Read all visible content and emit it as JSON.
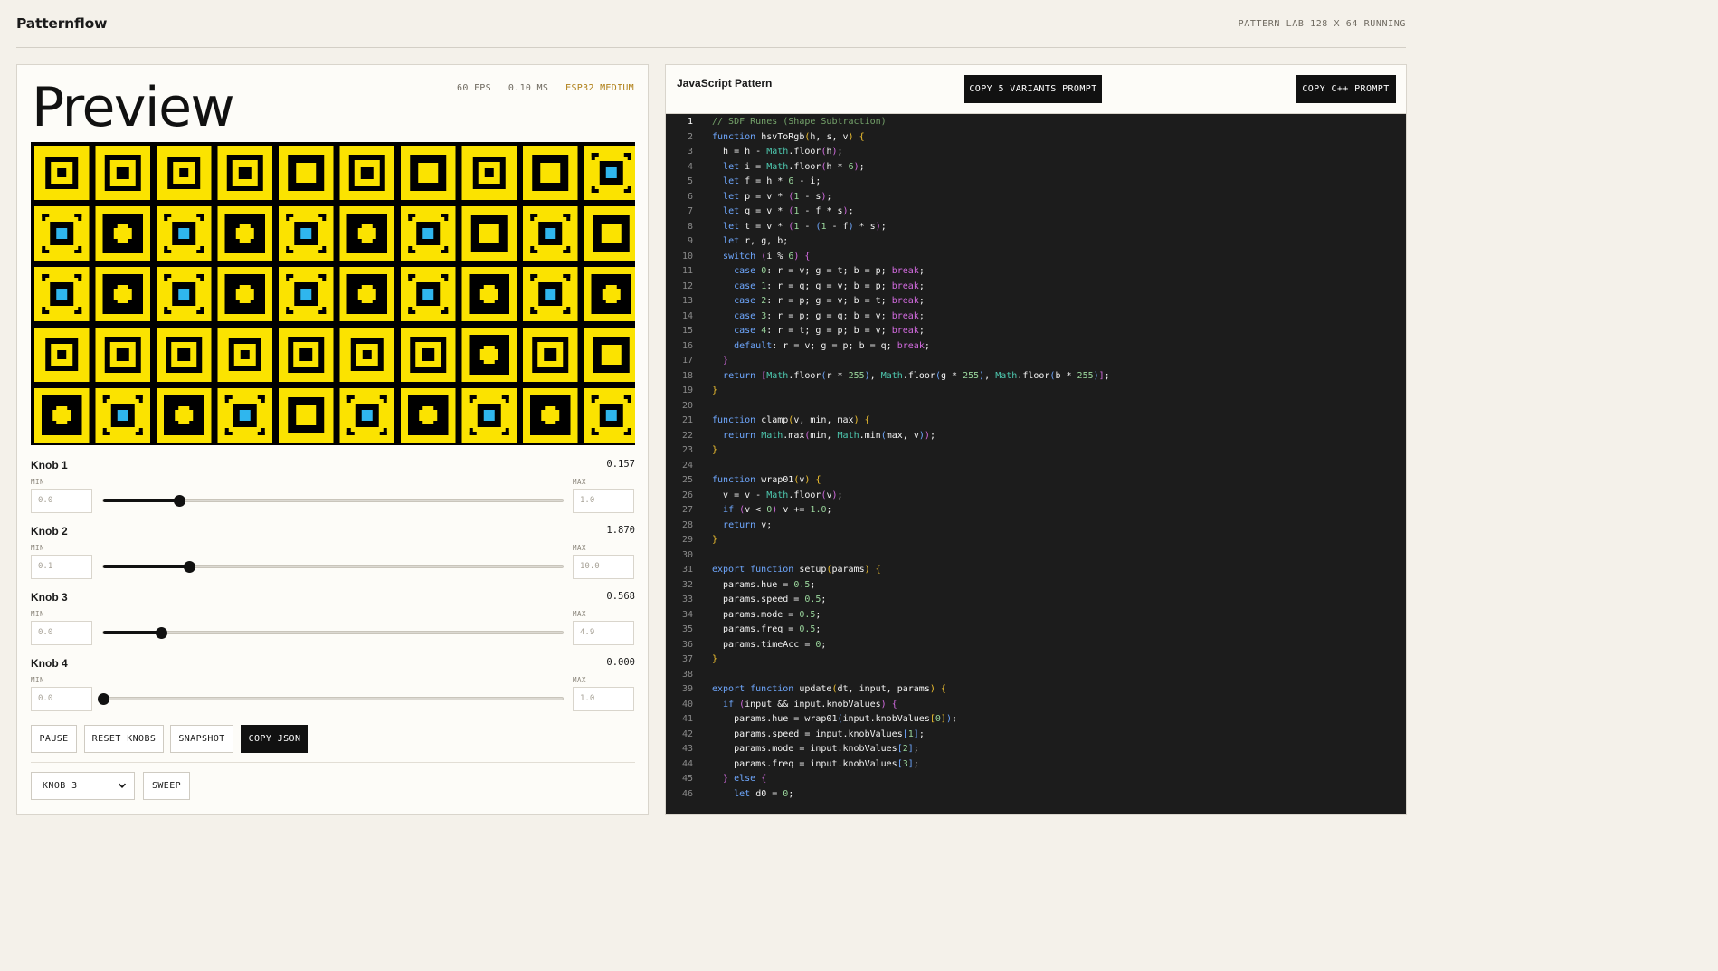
{
  "app": {
    "title": "Patternflow",
    "status": "PATTERN LAB  128 X 64  RUNNING"
  },
  "preview": {
    "title": "Preview",
    "fps": "60 FPS",
    "ms": "0.10 MS",
    "device": "ESP32 MEDIUM",
    "colors": {
      "background": "#000000",
      "fill": "#fbe300",
      "accent": "#2fb6ee"
    }
  },
  "knobs": [
    {
      "label": "Knob 1",
      "value": "0.157",
      "min_label": "MIN",
      "max_label": "MAX",
      "min": "0.0",
      "max": "1.0",
      "fraction": 0.165
    },
    {
      "label": "Knob 2",
      "value": "1.870",
      "min_label": "MIN",
      "max_label": "MAX",
      "min": "0.1",
      "max": "10.0",
      "fraction": 0.187
    },
    {
      "label": "Knob 3",
      "value": "0.568",
      "min_label": "MIN",
      "max_label": "MAX",
      "min": "0.0",
      "max": "4.9",
      "fraction": 0.125
    },
    {
      "label": "Knob 4",
      "value": "0.000",
      "min_label": "MIN",
      "max_label": "MAX",
      "min": "0.0",
      "max": "1.0",
      "fraction": 0.0
    }
  ],
  "controls": {
    "pause": "PAUSE",
    "reset": "RESET KNOBS",
    "snapshot": "SNAPSHOT",
    "copy_json": "COPY JSON",
    "knob_select": "KNOB 3",
    "sweep": "SWEEP"
  },
  "code_panel": {
    "title": "JavaScript Pattern",
    "copy_variants": "COPY 5 VARIANTS PROMPT",
    "copy_cpp": "COPY C++ PROMPT",
    "active_line": 1,
    "lines": [
      [
        [
          "cm",
          "// SDF Runes (Shape Subtraction)"
        ]
      ],
      [
        [
          "kw",
          "function "
        ],
        [
          "fn",
          "hsvToRgb"
        ],
        [
          "br",
          "("
        ],
        [
          "fn",
          "h, s, v"
        ],
        [
          "br",
          ")"
        ],
        [
          "fn",
          " "
        ],
        [
          "br",
          "{"
        ]
      ],
      [
        [
          "fn",
          "  h = h - "
        ],
        [
          "mth",
          "Math"
        ],
        [
          "fn",
          ".floor"
        ],
        [
          "ctl",
          "("
        ],
        [
          "fn",
          "h"
        ],
        [
          "ctl",
          ")"
        ],
        [
          "fn",
          ";"
        ]
      ],
      [
        [
          "fn",
          "  "
        ],
        [
          "kw",
          "let "
        ],
        [
          "fn",
          "i = "
        ],
        [
          "mth",
          "Math"
        ],
        [
          "fn",
          ".floor"
        ],
        [
          "ctl",
          "("
        ],
        [
          "fn",
          "h * "
        ],
        [
          "num",
          "6"
        ],
        [
          "ctl",
          ")"
        ],
        [
          "fn",
          ";"
        ]
      ],
      [
        [
          "fn",
          "  "
        ],
        [
          "kw",
          "let "
        ],
        [
          "fn",
          "f = h * "
        ],
        [
          "num",
          "6"
        ],
        [
          "fn",
          " - i;"
        ]
      ],
      [
        [
          "fn",
          "  "
        ],
        [
          "kw",
          "let "
        ],
        [
          "fn",
          "p = v * "
        ],
        [
          "ctl",
          "("
        ],
        [
          "num",
          "1"
        ],
        [
          "fn",
          " - s"
        ],
        [
          "ctl",
          ")"
        ],
        [
          "fn",
          ";"
        ]
      ],
      [
        [
          "fn",
          "  "
        ],
        [
          "kw",
          "let "
        ],
        [
          "fn",
          "q = v * "
        ],
        [
          "ctl",
          "("
        ],
        [
          "num",
          "1"
        ],
        [
          "fn",
          " - f * s"
        ],
        [
          "ctl",
          ")"
        ],
        [
          "fn",
          ";"
        ]
      ],
      [
        [
          "fn",
          "  "
        ],
        [
          "kw",
          "let "
        ],
        [
          "fn",
          "t = v * "
        ],
        [
          "ctl",
          "("
        ],
        [
          "num",
          "1"
        ],
        [
          "fn",
          " - "
        ],
        [
          "kw",
          "("
        ],
        [
          "num",
          "1"
        ],
        [
          "fn",
          " - f"
        ],
        [
          "kw",
          ")"
        ],
        [
          "fn",
          " * s"
        ],
        [
          "ctl",
          ")"
        ],
        [
          "fn",
          ";"
        ]
      ],
      [
        [
          "fn",
          "  "
        ],
        [
          "kw",
          "let "
        ],
        [
          "fn",
          "r, g, b;"
        ]
      ],
      [
        [
          "fn",
          "  "
        ],
        [
          "kw",
          "switch "
        ],
        [
          "ctl",
          "("
        ],
        [
          "fn",
          "i % "
        ],
        [
          "num",
          "6"
        ],
        [
          "ctl",
          ")"
        ],
        [
          "fn",
          " "
        ],
        [
          "ctl",
          "{"
        ]
      ],
      [
        [
          "fn",
          "    "
        ],
        [
          "kw",
          "case "
        ],
        [
          "num",
          "0"
        ],
        [
          "fn",
          ": r = v; g = t; b = p; "
        ],
        [
          "ctl",
          "break"
        ],
        [
          "fn",
          ";"
        ]
      ],
      [
        [
          "fn",
          "    "
        ],
        [
          "kw",
          "case "
        ],
        [
          "num",
          "1"
        ],
        [
          "fn",
          ": r = q; g = v; b = p; "
        ],
        [
          "ctl",
          "break"
        ],
        [
          "fn",
          ";"
        ]
      ],
      [
        [
          "fn",
          "    "
        ],
        [
          "kw",
          "case "
        ],
        [
          "num",
          "2"
        ],
        [
          "fn",
          ": r = p; g = v; b = t; "
        ],
        [
          "ctl",
          "break"
        ],
        [
          "fn",
          ";"
        ]
      ],
      [
        [
          "fn",
          "    "
        ],
        [
          "kw",
          "case "
        ],
        [
          "num",
          "3"
        ],
        [
          "fn",
          ": r = p; g = q; b = v; "
        ],
        [
          "ctl",
          "break"
        ],
        [
          "fn",
          ";"
        ]
      ],
      [
        [
          "fn",
          "    "
        ],
        [
          "kw",
          "case "
        ],
        [
          "num",
          "4"
        ],
        [
          "fn",
          ": r = t; g = p; b = v; "
        ],
        [
          "ctl",
          "break"
        ],
        [
          "fn",
          ";"
        ]
      ],
      [
        [
          "fn",
          "    "
        ],
        [
          "kw",
          "default"
        ],
        [
          "fn",
          ": r = v; g = p; b = q; "
        ],
        [
          "ctl",
          "break"
        ],
        [
          "fn",
          ";"
        ]
      ],
      [
        [
          "fn",
          "  "
        ],
        [
          "ctl",
          "}"
        ]
      ],
      [
        [
          "fn",
          "  "
        ],
        [
          "kw",
          "return "
        ],
        [
          "ctl",
          "["
        ],
        [
          "mth",
          "Math"
        ],
        [
          "fn",
          ".floor"
        ],
        [
          "kw",
          "("
        ],
        [
          "fn",
          "r * "
        ],
        [
          "num",
          "255"
        ],
        [
          "kw",
          ")"
        ],
        [
          "fn",
          ", "
        ],
        [
          "mth",
          "Math"
        ],
        [
          "fn",
          ".floor"
        ],
        [
          "kw",
          "("
        ],
        [
          "fn",
          "g * "
        ],
        [
          "num",
          "255"
        ],
        [
          "kw",
          ")"
        ],
        [
          "fn",
          ", "
        ],
        [
          "mth",
          "Math"
        ],
        [
          "fn",
          ".floor"
        ],
        [
          "kw",
          "("
        ],
        [
          "fn",
          "b * "
        ],
        [
          "num",
          "255"
        ],
        [
          "kw",
          ")"
        ],
        [
          "ctl",
          "]"
        ],
        [
          "fn",
          ";"
        ]
      ],
      [
        [
          "br",
          "}"
        ]
      ],
      [
        [
          "fn",
          ""
        ]
      ],
      [
        [
          "kw",
          "function "
        ],
        [
          "fn",
          "clamp"
        ],
        [
          "br",
          "("
        ],
        [
          "fn",
          "v, min, max"
        ],
        [
          "br",
          ")"
        ],
        [
          "fn",
          " "
        ],
        [
          "br",
          "{"
        ]
      ],
      [
        [
          "fn",
          "  "
        ],
        [
          "kw",
          "return "
        ],
        [
          "mth",
          "Math"
        ],
        [
          "fn",
          ".max"
        ],
        [
          "ctl",
          "("
        ],
        [
          "fn",
          "min, "
        ],
        [
          "mth",
          "Math"
        ],
        [
          "fn",
          ".min"
        ],
        [
          "kw",
          "("
        ],
        [
          "fn",
          "max, v"
        ],
        [
          "kw",
          ")"
        ],
        [
          "ctl",
          ")"
        ],
        [
          "fn",
          ";"
        ]
      ],
      [
        [
          "br",
          "}"
        ]
      ],
      [
        [
          "fn",
          ""
        ]
      ],
      [
        [
          "kw",
          "function "
        ],
        [
          "fn",
          "wrap01"
        ],
        [
          "br",
          "("
        ],
        [
          "fn",
          "v"
        ],
        [
          "br",
          ")"
        ],
        [
          "fn",
          " "
        ],
        [
          "br",
          "{"
        ]
      ],
      [
        [
          "fn",
          "  v = v - "
        ],
        [
          "mth",
          "Math"
        ],
        [
          "fn",
          ".floor"
        ],
        [
          "ctl",
          "("
        ],
        [
          "fn",
          "v"
        ],
        [
          "ctl",
          ")"
        ],
        [
          "fn",
          ";"
        ]
      ],
      [
        [
          "fn",
          "  "
        ],
        [
          "kw",
          "if "
        ],
        [
          "ctl",
          "("
        ],
        [
          "fn",
          "v < "
        ],
        [
          "num",
          "0"
        ],
        [
          "ctl",
          ")"
        ],
        [
          "fn",
          " v += "
        ],
        [
          "num",
          "1.0"
        ],
        [
          "fn",
          ";"
        ]
      ],
      [
        [
          "fn",
          "  "
        ],
        [
          "kw",
          "return "
        ],
        [
          "fn",
          "v;"
        ]
      ],
      [
        [
          "br",
          "}"
        ]
      ],
      [
        [
          "fn",
          ""
        ]
      ],
      [
        [
          "kw",
          "export function "
        ],
        [
          "fn",
          "setup"
        ],
        [
          "br",
          "("
        ],
        [
          "fn",
          "params"
        ],
        [
          "br",
          ")"
        ],
        [
          "fn",
          " "
        ],
        [
          "br",
          "{"
        ]
      ],
      [
        [
          "fn",
          "  params.hue = "
        ],
        [
          "num",
          "0.5"
        ],
        [
          "fn",
          ";"
        ]
      ],
      [
        [
          "fn",
          "  params.speed = "
        ],
        [
          "num",
          "0.5"
        ],
        [
          "fn",
          ";"
        ]
      ],
      [
        [
          "fn",
          "  params.mode = "
        ],
        [
          "num",
          "0.5"
        ],
        [
          "fn",
          ";"
        ]
      ],
      [
        [
          "fn",
          "  params.freq = "
        ],
        [
          "num",
          "0.5"
        ],
        [
          "fn",
          ";"
        ]
      ],
      [
        [
          "fn",
          "  params.timeAcc = "
        ],
        [
          "num",
          "0"
        ],
        [
          "fn",
          ";"
        ]
      ],
      [
        [
          "br",
          "}"
        ]
      ],
      [
        [
          "fn",
          ""
        ]
      ],
      [
        [
          "kw",
          "export function "
        ],
        [
          "fn",
          "update"
        ],
        [
          "br",
          "("
        ],
        [
          "fn",
          "dt, input, params"
        ],
        [
          "br",
          ")"
        ],
        [
          "fn",
          " "
        ],
        [
          "br",
          "{"
        ]
      ],
      [
        [
          "fn",
          "  "
        ],
        [
          "kw",
          "if "
        ],
        [
          "ctl",
          "("
        ],
        [
          "fn",
          "input && input.knobValues"
        ],
        [
          "ctl",
          ")"
        ],
        [
          "fn",
          " "
        ],
        [
          "ctl",
          "{"
        ]
      ],
      [
        [
          "fn",
          "    params.hue = wrap01"
        ],
        [
          "kw",
          "("
        ],
        [
          "fn",
          "input.knobValues"
        ],
        [
          "br",
          "["
        ],
        [
          "num",
          "0"
        ],
        [
          "br",
          "]"
        ],
        [
          "kw",
          ")"
        ],
        [
          "fn",
          ";"
        ]
      ],
      [
        [
          "fn",
          "    params.speed = input.knobValues"
        ],
        [
          "kw",
          "["
        ],
        [
          "num",
          "1"
        ],
        [
          "kw",
          "]"
        ],
        [
          "fn",
          ";"
        ]
      ],
      [
        [
          "fn",
          "    params.mode = input.knobValues"
        ],
        [
          "kw",
          "["
        ],
        [
          "num",
          "2"
        ],
        [
          "kw",
          "]"
        ],
        [
          "fn",
          ";"
        ]
      ],
      [
        [
          "fn",
          "    params.freq = input.knobValues"
        ],
        [
          "kw",
          "["
        ],
        [
          "num",
          "3"
        ],
        [
          "kw",
          "]"
        ],
        [
          "fn",
          ";"
        ]
      ],
      [
        [
          "fn",
          "  "
        ],
        [
          "ctl",
          "}"
        ],
        [
          "fn",
          " "
        ],
        [
          "kw",
          "else "
        ],
        [
          "ctl",
          "{"
        ]
      ],
      [
        [
          "fn",
          "    "
        ],
        [
          "kw",
          "let "
        ],
        [
          "fn",
          "d0 = "
        ],
        [
          "num",
          "0"
        ],
        [
          "fn",
          ";"
        ]
      ]
    ]
  }
}
